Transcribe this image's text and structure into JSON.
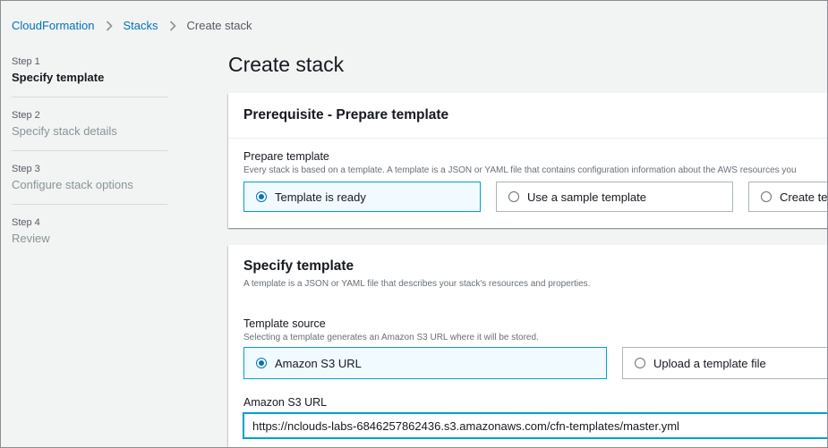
{
  "breadcrumb": {
    "items": [
      {
        "label": "CloudFormation"
      },
      {
        "label": "Stacks"
      },
      {
        "label": "Create stack"
      }
    ]
  },
  "steps": [
    {
      "num": "Step 1",
      "title": "Specify template",
      "active": true
    },
    {
      "num": "Step 2",
      "title": "Specify stack details"
    },
    {
      "num": "Step 3",
      "title": "Configure stack options"
    },
    {
      "num": "Step 4",
      "title": "Review"
    }
  ],
  "page_title": "Create stack",
  "prerequisite": {
    "heading": "Prerequisite - Prepare template",
    "label": "Prepare template",
    "description": "Every stack is based on a template. A template is a JSON or YAML file that contains configuration information about the AWS resources you",
    "options": [
      {
        "label": "Template is ready",
        "selected": true
      },
      {
        "label": "Use a sample template",
        "selected": false
      },
      {
        "label": "Create ter",
        "selected": false
      }
    ]
  },
  "specify": {
    "heading": "Specify template",
    "description": "A template is a JSON or YAML file that describes your stack's resources and properties.",
    "source_label": "Template source",
    "source_desc": "Selecting a template generates an Amazon S3 URL where it will be stored.",
    "options": [
      {
        "label": "Amazon S3 URL",
        "selected": true
      },
      {
        "label": "Upload a template file",
        "selected": false
      }
    ],
    "url_label": "Amazon S3 URL",
    "url_value": "https://nclouds-labs-6846257862436.s3.amazonaws.com/cfn-templates/master.yml"
  },
  "colors": {
    "link": "#0073bb",
    "selected_border": "#00a1c9",
    "selected_bg": "#f1faff",
    "page_bg": "#f2f3f3"
  }
}
